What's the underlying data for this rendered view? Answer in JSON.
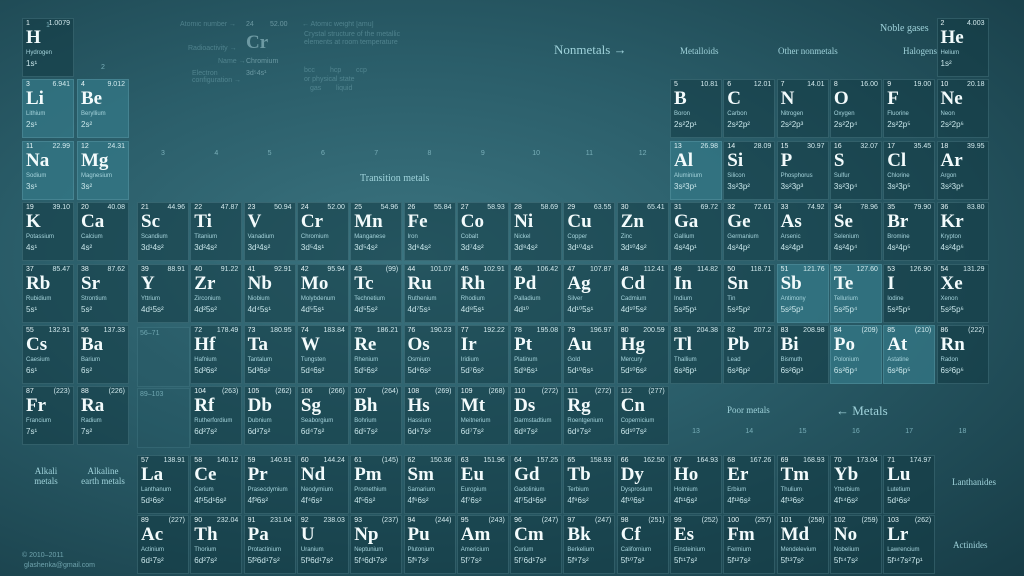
{
  "labels": {
    "noble_gases": "Noble gases",
    "nonmetals": "Nonmetals →",
    "metalloids": "Metalloids",
    "other_nonmetals": "Other nonmetals",
    "halogens": "Halogens",
    "transition_metals": "Transition metals",
    "poor_metals": "Poor metals",
    "metals": "← Metals",
    "alkali_metals": "Alkali metals",
    "alkaline_earth_metals": "Alkaline earth metals",
    "lanthanides": "Lanthanides",
    "actinides": "Actinides",
    "copyright": "© 2010–2011",
    "email": "glashenka@gmail.com",
    "la_range": "56–71",
    "ac_range": "89–103"
  },
  "legend": {
    "atomic_number": "Atomic number →",
    "num": "24",
    "mass": "52.00",
    "atomic_weight": "← Atomic weight [amu]",
    "radioactivity": "Radioactivity →",
    "symbol": "Cr",
    "name_label": "Name →",
    "name": "Chromium",
    "electron_config": "Electron configuration →",
    "config": "3d⁵4s¹",
    "crystal": "Crystal structure of the metallic elements at room temperature",
    "bcc": "bcc",
    "hcp": "hcp",
    "ccp": "ccp",
    "physical_state": "or physical state",
    "gas": "gas",
    "liquid": "liquid"
  },
  "group_numbers": [
    "1",
    "2",
    "3",
    "4",
    "5",
    "6",
    "7",
    "8",
    "9",
    "10",
    "11",
    "12",
    "13",
    "14",
    "15",
    "16",
    "17",
    "18"
  ],
  "elements": [
    [
      "1",
      "1.0079",
      "H",
      "Hydrogen",
      "1s¹",
      1,
      1,
      0
    ],
    [
      "2",
      "4.003",
      "He",
      "Helium",
      "1s²",
      18,
      1,
      0
    ],
    [
      "3",
      "6.941",
      "Li",
      "Lithium",
      "2s¹",
      1,
      2,
      1
    ],
    [
      "4",
      "9.012",
      "Be",
      "Beryllium",
      "2s²",
      2,
      2,
      1
    ],
    [
      "5",
      "10.81",
      "B",
      "Boron",
      "2s²2p¹",
      13,
      2,
      0
    ],
    [
      "6",
      "12.01",
      "C",
      "Carbon",
      "2s²2p²",
      14,
      2,
      0
    ],
    [
      "7",
      "14.01",
      "N",
      "Nitrogen",
      "2s²2p³",
      15,
      2,
      0
    ],
    [
      "8",
      "16.00",
      "O",
      "Oxygen",
      "2s²2p⁴",
      16,
      2,
      0
    ],
    [
      "9",
      "19.00",
      "F",
      "Fluorine",
      "2s²2p⁵",
      17,
      2,
      0
    ],
    [
      "10",
      "20.18",
      "Ne",
      "Neon",
      "2s²2p⁶",
      18,
      2,
      0
    ],
    [
      "11",
      "22.99",
      "Na",
      "Sodium",
      "3s¹",
      1,
      3,
      1
    ],
    [
      "12",
      "24.31",
      "Mg",
      "Magnesium",
      "3s²",
      2,
      3,
      1
    ],
    [
      "13",
      "26.98",
      "Al",
      "Aluminium",
      "3s²3p¹",
      13,
      3,
      1
    ],
    [
      "14",
      "28.09",
      "Si",
      "Silicon",
      "3s²3p²",
      14,
      3,
      0
    ],
    [
      "15",
      "30.97",
      "P",
      "Phosphorus",
      "3s²3p³",
      15,
      3,
      0
    ],
    [
      "16",
      "32.07",
      "S",
      "Sulfur",
      "3s²3p⁴",
      16,
      3,
      0
    ],
    [
      "17",
      "35.45",
      "Cl",
      "Chlorine",
      "3s²3p⁵",
      17,
      3,
      0
    ],
    [
      "18",
      "39.95",
      "Ar",
      "Argon",
      "3s²3p⁶",
      18,
      3,
      0
    ],
    [
      "19",
      "39.10",
      "K",
      "Potassium",
      "4s¹",
      1,
      4,
      0
    ],
    [
      "20",
      "40.08",
      "Ca",
      "Calcium",
      "4s²",
      2,
      4,
      0
    ],
    [
      "21",
      "44.96",
      "Sc",
      "Scandium",
      "3d¹4s²",
      3,
      4,
      0
    ],
    [
      "22",
      "47.87",
      "Ti",
      "Titanium",
      "3d²4s²",
      4,
      4,
      0
    ],
    [
      "23",
      "50.94",
      "V",
      "Vanadium",
      "3d³4s²",
      5,
      4,
      0
    ],
    [
      "24",
      "52.00",
      "Cr",
      "Chromium",
      "3d⁵4s¹",
      6,
      4,
      0
    ],
    [
      "25",
      "54.96",
      "Mn",
      "Manganese",
      "3d⁵4s²",
      7,
      4,
      0
    ],
    [
      "26",
      "55.84",
      "Fe",
      "Iron",
      "3d⁶4s²",
      8,
      4,
      0
    ],
    [
      "27",
      "58.93",
      "Co",
      "Cobalt",
      "3d⁷4s²",
      9,
      4,
      0
    ],
    [
      "28",
      "58.69",
      "Ni",
      "Nickel",
      "3d⁸4s²",
      10,
      4,
      0
    ],
    [
      "29",
      "63.55",
      "Cu",
      "Copper",
      "3d¹⁰4s¹",
      11,
      4,
      0
    ],
    [
      "30",
      "65.41",
      "Zn",
      "Zinc",
      "3d¹⁰4s²",
      12,
      4,
      0
    ],
    [
      "31",
      "69.72",
      "Ga",
      "Gallium",
      "4s²4p¹",
      13,
      4,
      0
    ],
    [
      "32",
      "72.61",
      "Ge",
      "Germanium",
      "4s²4p²",
      14,
      4,
      0
    ],
    [
      "33",
      "74.92",
      "As",
      "Arsenic",
      "4s²4p³",
      15,
      4,
      0
    ],
    [
      "34",
      "78.96",
      "Se",
      "Selenium",
      "4s²4p⁴",
      16,
      4,
      0
    ],
    [
      "35",
      "79.90",
      "Br",
      "Bromine",
      "4s²4p⁵",
      17,
      4,
      0
    ],
    [
      "36",
      "83.80",
      "Kr",
      "Krypton",
      "4s²4p⁶",
      18,
      4,
      0
    ],
    [
      "37",
      "85.47",
      "Rb",
      "Rubidium",
      "5s¹",
      1,
      5,
      0
    ],
    [
      "38",
      "87.62",
      "Sr",
      "Strontium",
      "5s²",
      2,
      5,
      0
    ],
    [
      "39",
      "88.91",
      "Y",
      "Yttrium",
      "4d¹5s²",
      3,
      5,
      0
    ],
    [
      "40",
      "91.22",
      "Zr",
      "Zirconium",
      "4d²5s²",
      4,
      5,
      0
    ],
    [
      "41",
      "92.91",
      "Nb",
      "Niobium",
      "4d⁴5s¹",
      5,
      5,
      0
    ],
    [
      "42",
      "95.94",
      "Mo",
      "Molybdenum",
      "4d⁵5s¹",
      6,
      5,
      0
    ],
    [
      "43",
      "(99)",
      "Tc",
      "Technetium",
      "4d⁵5s²",
      7,
      5,
      0
    ],
    [
      "44",
      "101.07",
      "Ru",
      "Ruthenium",
      "4d⁷5s¹",
      8,
      5,
      0
    ],
    [
      "45",
      "102.91",
      "Rh",
      "Rhodium",
      "4d⁸5s¹",
      9,
      5,
      0
    ],
    [
      "46",
      "106.42",
      "Pd",
      "Palladium",
      "4d¹⁰",
      10,
      5,
      0
    ],
    [
      "47",
      "107.87",
      "Ag",
      "Silver",
      "4d¹⁰5s¹",
      11,
      5,
      0
    ],
    [
      "48",
      "112.41",
      "Cd",
      "Cadmium",
      "4d¹⁰5s²",
      12,
      5,
      0
    ],
    [
      "49",
      "114.82",
      "In",
      "Indium",
      "5s²5p¹",
      13,
      5,
      0
    ],
    [
      "50",
      "118.71",
      "Sn",
      "Tin",
      "5s²5p²",
      14,
      5,
      0
    ],
    [
      "51",
      "121.76",
      "Sb",
      "Antimony",
      "5s²5p³",
      15,
      5,
      1
    ],
    [
      "52",
      "127.60",
      "Te",
      "Tellurium",
      "5s²5p⁴",
      16,
      5,
      1
    ],
    [
      "53",
      "126.90",
      "I",
      "Iodine",
      "5s²5p⁵",
      17,
      5,
      0
    ],
    [
      "54",
      "131.29",
      "Xe",
      "Xenon",
      "5s²5p⁶",
      18,
      5,
      0
    ],
    [
      "55",
      "132.91",
      "Cs",
      "Caesium",
      "6s¹",
      1,
      6,
      0
    ],
    [
      "56",
      "137.33",
      "Ba",
      "Barium",
      "6s²",
      2,
      6,
      0
    ],
    [
      "72",
      "178.49",
      "Hf",
      "Hafnium",
      "5d²6s²",
      4,
      6,
      0
    ],
    [
      "73",
      "180.95",
      "Ta",
      "Tantalum",
      "5d³6s²",
      5,
      6,
      0
    ],
    [
      "74",
      "183.84",
      "W",
      "Tungsten",
      "5d⁴6s²",
      6,
      6,
      0
    ],
    [
      "75",
      "186.21",
      "Re",
      "Rhenium",
      "5d⁵6s²",
      7,
      6,
      0
    ],
    [
      "76",
      "190.23",
      "Os",
      "Osmium",
      "5d⁶6s²",
      8,
      6,
      0
    ],
    [
      "77",
      "192.22",
      "Ir",
      "Iridium",
      "5d⁷6s²",
      9,
      6,
      0
    ],
    [
      "78",
      "195.08",
      "Pt",
      "Platinum",
      "5d⁹6s¹",
      10,
      6,
      0
    ],
    [
      "79",
      "196.97",
      "Au",
      "Gold",
      "5d¹⁰6s¹",
      11,
      6,
      0
    ],
    [
      "80",
      "200.59",
      "Hg",
      "Mercury",
      "5d¹⁰6s²",
      12,
      6,
      0
    ],
    [
      "81",
      "204.38",
      "Tl",
      "Thallium",
      "6s²6p¹",
      13,
      6,
      0
    ],
    [
      "82",
      "207.2",
      "Pb",
      "Lead",
      "6s²6p²",
      14,
      6,
      0
    ],
    [
      "83",
      "208.98",
      "Bi",
      "Bismuth",
      "6s²6p³",
      15,
      6,
      0
    ],
    [
      "84",
      "(209)",
      "Po",
      "Polonium",
      "6s²6p⁴",
      16,
      6,
      1
    ],
    [
      "85",
      "(210)",
      "At",
      "Astatine",
      "6s²6p⁵",
      17,
      6,
      1
    ],
    [
      "86",
      "(222)",
      "Rn",
      "Radon",
      "6s²6p⁶",
      18,
      6,
      0
    ],
    [
      "87",
      "(223)",
      "Fr",
      "Francium",
      "7s¹",
      1,
      7,
      0
    ],
    [
      "88",
      "(226)",
      "Ra",
      "Radium",
      "7s²",
      2,
      7,
      0
    ],
    [
      "104",
      "(263)",
      "Rf",
      "Rutherfordium",
      "6d²7s²",
      4,
      7,
      0
    ],
    [
      "105",
      "(262)",
      "Db",
      "Dubnium",
      "6d³7s²",
      5,
      7,
      0
    ],
    [
      "106",
      "(266)",
      "Sg",
      "Seaborgium",
      "6d⁴7s²",
      6,
      7,
      0
    ],
    [
      "107",
      "(264)",
      "Bh",
      "Bohrium",
      "6d⁵7s²",
      7,
      7,
      0
    ],
    [
      "108",
      "(269)",
      "Hs",
      "Hassium",
      "6d⁶7s²",
      8,
      7,
      0
    ],
    [
      "109",
      "(268)",
      "Mt",
      "Meitnerium",
      "6d⁷7s²",
      9,
      7,
      0
    ],
    [
      "110",
      "(272)",
      "Ds",
      "Darmstadtium",
      "6d⁸7s²",
      10,
      7,
      0
    ],
    [
      "111",
      "(272)",
      "Rg",
      "Roentgenium",
      "6d⁹7s²",
      11,
      7,
      0
    ],
    [
      "112",
      "(277)",
      "Cn",
      "Copernicium",
      "6d¹⁰7s²",
      12,
      7,
      0
    ]
  ],
  "lanthanides": [
    [
      "57",
      "138.91",
      "La",
      "Lanthanum",
      "5d¹6s²"
    ],
    [
      "58",
      "140.12",
      "Ce",
      "Cerium",
      "4f¹5d¹6s²"
    ],
    [
      "59",
      "140.91",
      "Pr",
      "Praseodymium",
      "4f³6s²"
    ],
    [
      "60",
      "144.24",
      "Nd",
      "Neodymium",
      "4f⁴6s²"
    ],
    [
      "61",
      "(145)",
      "Pm",
      "Promethium",
      "4f⁵6s²"
    ],
    [
      "62",
      "150.36",
      "Sm",
      "Samarium",
      "4f⁶6s²"
    ],
    [
      "63",
      "151.96",
      "Eu",
      "Europium",
      "4f⁷6s²"
    ],
    [
      "64",
      "157.25",
      "Gd",
      "Gadolinium",
      "4f⁷5d¹6s²"
    ],
    [
      "65",
      "158.93",
      "Tb",
      "Terbium",
      "4f⁹6s²"
    ],
    [
      "66",
      "162.50",
      "Dy",
      "Dysprosium",
      "4f¹⁰6s²"
    ],
    [
      "67",
      "164.93",
      "Ho",
      "Holmium",
      "4f¹¹6s²"
    ],
    [
      "68",
      "167.26",
      "Er",
      "Erbium",
      "4f¹²6s²"
    ],
    [
      "69",
      "168.93",
      "Tm",
      "Thulium",
      "4f¹³6s²"
    ],
    [
      "70",
      "173.04",
      "Yb",
      "Ytterbium",
      "4f¹⁴6s²"
    ],
    [
      "71",
      "174.97",
      "Lu",
      "Lutetium",
      "5d¹6s²"
    ]
  ],
  "actinides": [
    [
      "89",
      "(227)",
      "Ac",
      "Actinium",
      "6d¹7s²"
    ],
    [
      "90",
      "232.04",
      "Th",
      "Thorium",
      "6d²7s²"
    ],
    [
      "91",
      "231.04",
      "Pa",
      "Protactinium",
      "5f²6d¹7s²"
    ],
    [
      "92",
      "238.03",
      "U",
      "Uranium",
      "5f³6d¹7s²"
    ],
    [
      "93",
      "(237)",
      "Np",
      "Neptunium",
      "5f⁴6d¹7s²"
    ],
    [
      "94",
      "(244)",
      "Pu",
      "Plutonium",
      "5f⁶7s²"
    ],
    [
      "95",
      "(243)",
      "Am",
      "Americium",
      "5f⁷7s²"
    ],
    [
      "96",
      "(247)",
      "Cm",
      "Curium",
      "5f⁷6d¹7s²"
    ],
    [
      "97",
      "(247)",
      "Bk",
      "Berkelium",
      "5f⁹7s²"
    ],
    [
      "98",
      "(251)",
      "Cf",
      "Californium",
      "5f¹⁰7s²"
    ],
    [
      "99",
      "(252)",
      "Es",
      "Einsteinium",
      "5f¹¹7s²"
    ],
    [
      "100",
      "(257)",
      "Fm",
      "Fermium",
      "5f¹²7s²"
    ],
    [
      "101",
      "(258)",
      "Md",
      "Mendelevium",
      "5f¹³7s²"
    ],
    [
      "102",
      "(259)",
      "No",
      "Nobelium",
      "5f¹⁴7s²"
    ],
    [
      "103",
      "(262)",
      "Lr",
      "Lawrencium",
      "5f¹⁴7s²7p¹"
    ]
  ]
}
